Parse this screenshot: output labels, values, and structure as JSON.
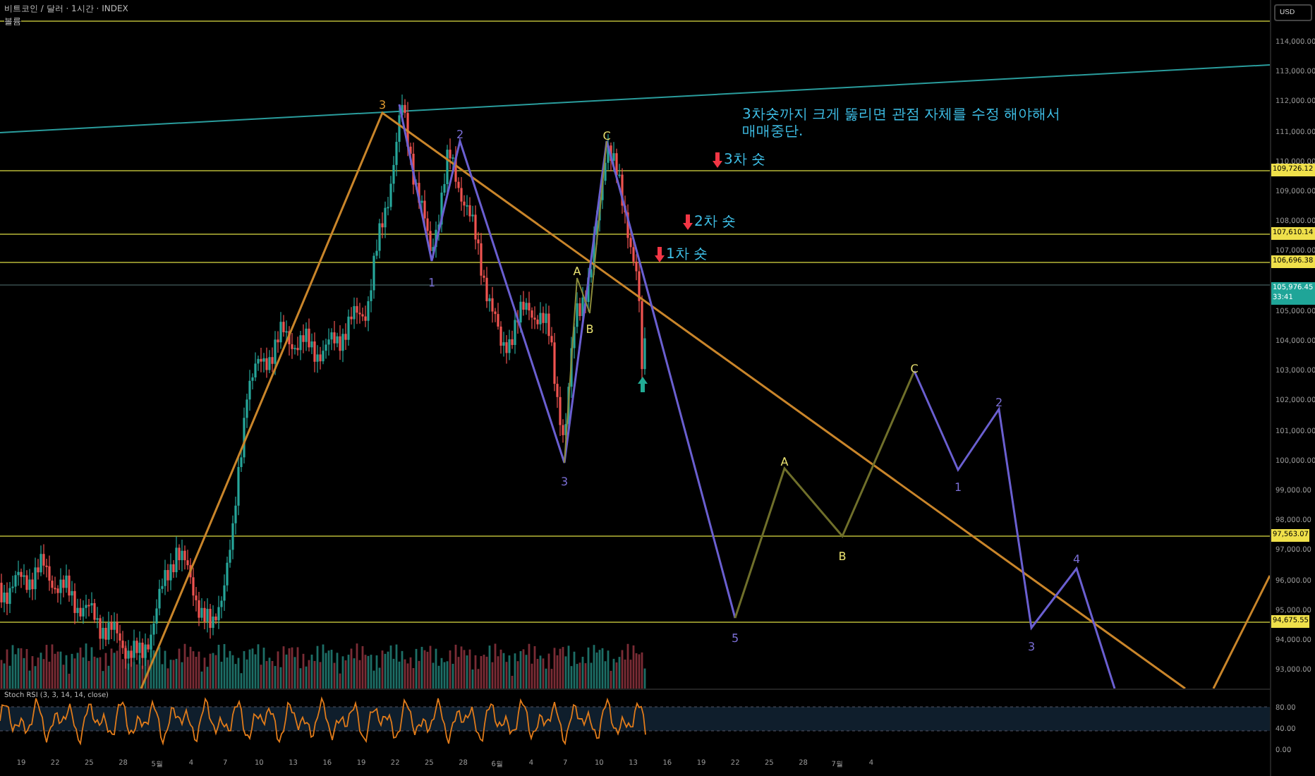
{
  "header": {
    "title": "비트코인 / 달러 · 1시간 · INDEX",
    "subtitle": "볼륨"
  },
  "currency_button": "USD",
  "price_axis": {
    "labels": [
      "114,000.00",
      "113,000.00",
      "112,000.00",
      "111,000.00",
      "110,000.00",
      "109,000.00",
      "108,000.00",
      "107,000.00",
      "105,000.00",
      "104,000.00",
      "103,000.00",
      "102,000.00",
      "101,000.00",
      "100,000.00",
      "99,000.00",
      "98,000.00",
      "97,000.00",
      "96,000.00",
      "95,000.00",
      "94,000.00",
      "93,000.00"
    ]
  },
  "price_tags": [
    {
      "kind": "level",
      "text": "109,726.12"
    },
    {
      "kind": "level",
      "text": "107,610.14"
    },
    {
      "kind": "level",
      "text": "106,696.38"
    },
    {
      "kind": "last",
      "text": "105,976.45",
      "subtext": "33:41"
    },
    {
      "kind": "level",
      "text": "97,563.07"
    },
    {
      "kind": "level",
      "text": "94,675.55"
    }
  ],
  "note": "3차숏까지 크게 뚫리면 관점 자체를 수정 해야해서 매매중단.",
  "entries": [
    {
      "label": "3차 숏"
    },
    {
      "label": "2차 숏"
    },
    {
      "label": "1차 숏"
    }
  ],
  "wave_labels": [
    {
      "text": "3",
      "color": "#e09a30"
    },
    {
      "text": "2",
      "color": "#7b6fd6"
    },
    {
      "text": "1",
      "color": "#7b6fd6"
    },
    {
      "text": "3",
      "color": "#7b6fd6"
    },
    {
      "text": "A",
      "color": "#e8e070"
    },
    {
      "text": "B",
      "color": "#e8e070"
    },
    {
      "text": "C",
      "color": "#e8e070"
    },
    {
      "text": "5",
      "color": "#7b6fd6"
    },
    {
      "text": "A",
      "color": "#e8e070"
    },
    {
      "text": "B",
      "color": "#e8e070"
    },
    {
      "text": "C",
      "color": "#e8e070"
    },
    {
      "text": "1",
      "color": "#7b6fd6"
    },
    {
      "text": "2",
      "color": "#7b6fd6"
    },
    {
      "text": "3",
      "color": "#7b6fd6"
    },
    {
      "text": "4",
      "color": "#7b6fd6"
    }
  ],
  "indicator": {
    "title": "Stoch RSI (3, 3, 14, 14, close)",
    "labels": [
      "80.00",
      "40.00",
      "0.00"
    ]
  },
  "time_axis": {
    "labels": [
      "19",
      "22",
      "25",
      "28",
      "5월",
      "4",
      "7",
      "10",
      "13",
      "16",
      "19",
      "22",
      "25",
      "28",
      "6월",
      "4",
      "7",
      "10",
      "13",
      "16",
      "19",
      "22",
      "25",
      "28",
      "7월",
      "4"
    ]
  }
}
